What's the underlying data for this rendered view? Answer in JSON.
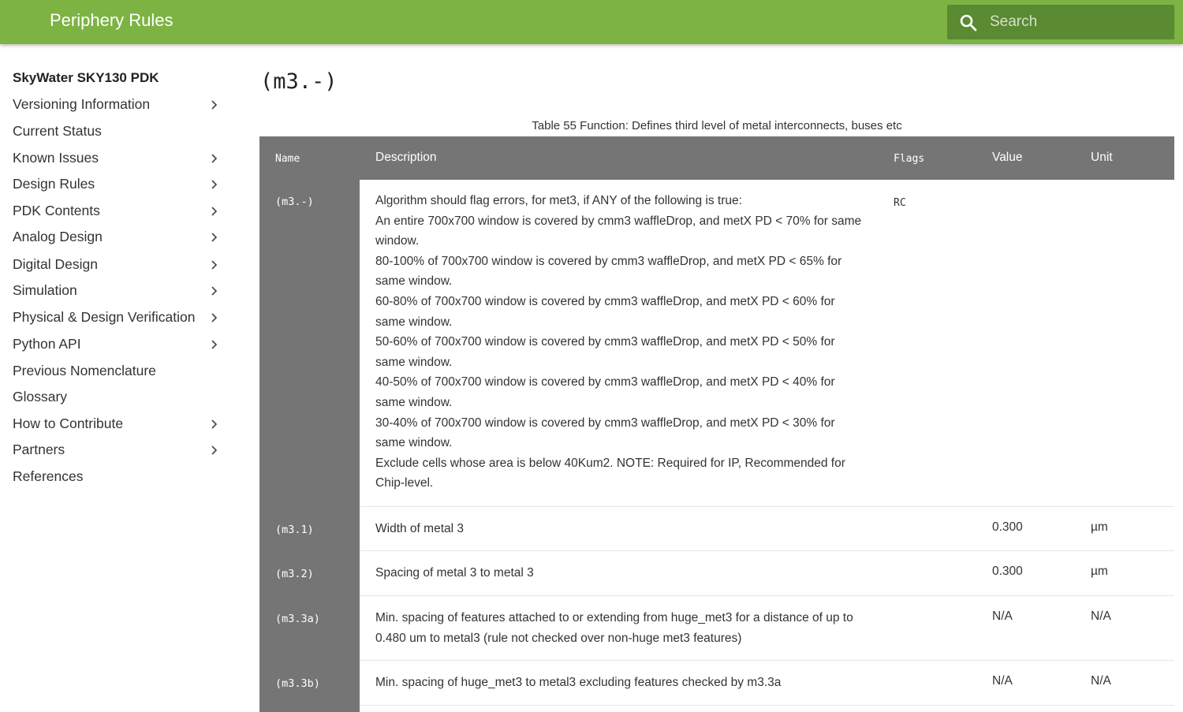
{
  "header": {
    "title": "Periphery Rules",
    "search_placeholder": "Search",
    "search_value": "",
    "accent_color": "#7cb342"
  },
  "sidebar": {
    "title": "SkyWater SKY130 PDK",
    "items": [
      {
        "label": "Versioning Information",
        "has_children": true
      },
      {
        "label": "Current Status",
        "has_children": false
      },
      {
        "label": "Known Issues",
        "has_children": true
      },
      {
        "label": "Design Rules",
        "has_children": true
      },
      {
        "label": "PDK Contents",
        "has_children": true
      },
      {
        "label": "Analog Design",
        "has_children": true
      },
      {
        "label": "Digital Design",
        "has_children": true
      },
      {
        "label": "Simulation",
        "has_children": true
      },
      {
        "label": "Physical & Design Verification",
        "has_children": true
      },
      {
        "label": "Python API",
        "has_children": true
      },
      {
        "label": "Previous Nomenclature",
        "has_children": false
      },
      {
        "label": "Glossary",
        "has_children": false
      },
      {
        "label": "How to Contribute",
        "has_children": true
      },
      {
        "label": "Partners",
        "has_children": true
      },
      {
        "label": "References",
        "has_children": false
      }
    ]
  },
  "main": {
    "title": "(m3.-)",
    "caption": "Table 55 Function: Defines third level of metal interconnects, buses etc",
    "table": {
      "headers": {
        "name": "Name",
        "description": "Description",
        "flags": "Flags",
        "value": "Value",
        "unit": "Unit"
      },
      "rows": [
        {
          "name": "(m3.-)",
          "description": [
            "Algorithm should flag errors, for met3, if ANY of the following is true:",
            "An entire 700x700 window is covered by cmm3 waffleDrop, and metX PD < 70% for same window.",
            "80-100% of 700x700 window is covered by cmm3 waffleDrop, and metX PD < 65% for same window.",
            "60-80% of 700x700 window is covered by cmm3 waffleDrop, and metX PD < 60% for same window.",
            "50-60% of 700x700 window is covered by cmm3 waffleDrop, and metX PD < 50% for same window.",
            "40-50% of 700x700 window is covered by cmm3 waffleDrop, and metX PD < 40% for same window.",
            "30-40% of 700x700 window is covered by cmm3 waffleDrop, and metX PD < 30% for same window.",
            "Exclude cells whose area is below 40Kum2. NOTE: Required for IP, Recommended for Chip-level."
          ],
          "flags": "RC",
          "value": "",
          "unit": ""
        },
        {
          "name": "(m3.1)",
          "description": [
            "Width of metal 3"
          ],
          "flags": "",
          "value": "0.300",
          "unit": "µm"
        },
        {
          "name": "(m3.2)",
          "description": [
            "Spacing of metal 3 to metal 3"
          ],
          "flags": "",
          "value": "0.300",
          "unit": "µm"
        },
        {
          "name": "(m3.3a)",
          "description": [
            "Min. spacing of features attached to or extending from huge_met3 for a distance of up to 0.480 um to metal3 (rule not checked over non-huge met3 features)"
          ],
          "flags": "",
          "value": "N/A",
          "unit": "N/A"
        },
        {
          "name": "(m3.3b)",
          "description": [
            "Min. spacing of huge_met3 to metal3 excluding features checked by m3.3a"
          ],
          "flags": "",
          "value": "N/A",
          "unit": "N/A"
        }
      ]
    }
  }
}
